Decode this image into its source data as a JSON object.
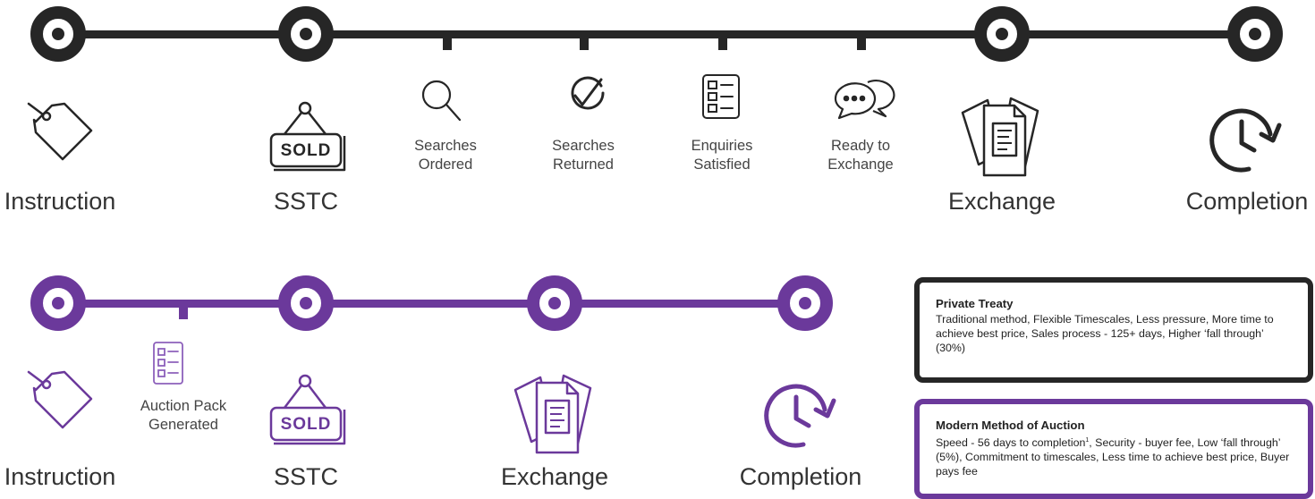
{
  "traditional": {
    "milestones": [
      "Instruction",
      "SSTC",
      "Exchange",
      "Completion"
    ],
    "steps": [
      {
        "line1": "Searches",
        "line2": "Ordered",
        "icon": "search-icon"
      },
      {
        "line1": "Searches",
        "line2": "Returned",
        "icon": "checkmark-icon"
      },
      {
        "line1": "Enquiries",
        "line2": "Satisfied",
        "icon": "checklist-icon"
      },
      {
        "line1": "Ready to",
        "line2": "Exchange",
        "icon": "chat-bubbles-icon"
      }
    ]
  },
  "auction": {
    "milestones": [
      "Instruction",
      "SSTC",
      "Exchange",
      "Completion"
    ],
    "steps": [
      {
        "line1": "Auction Pack",
        "line2": "Generated",
        "icon": "checklist-icon"
      }
    ]
  },
  "sold_sign_text": "SOLD",
  "boxes": {
    "private_treaty": {
      "title": "Private Treaty",
      "body": "Traditional method, Flexible Timescales, Less pressure, More time to achieve best price, Sales process - 125+ days, Higher ‘fall through’ (30%)"
    },
    "mma": {
      "title": "Modern Method of Auction",
      "body_part1": "Speed - 56 days to completion",
      "superscript": "1",
      "body_part2": ", Security - buyer fee, Low ‘fall through’ (5%), Commitment to timescales, Less time to achieve best price, Buyer pays fee"
    }
  },
  "colors": {
    "dark": "#262626",
    "purple": "#6b399b",
    "purple_light": "#8d60bb"
  }
}
